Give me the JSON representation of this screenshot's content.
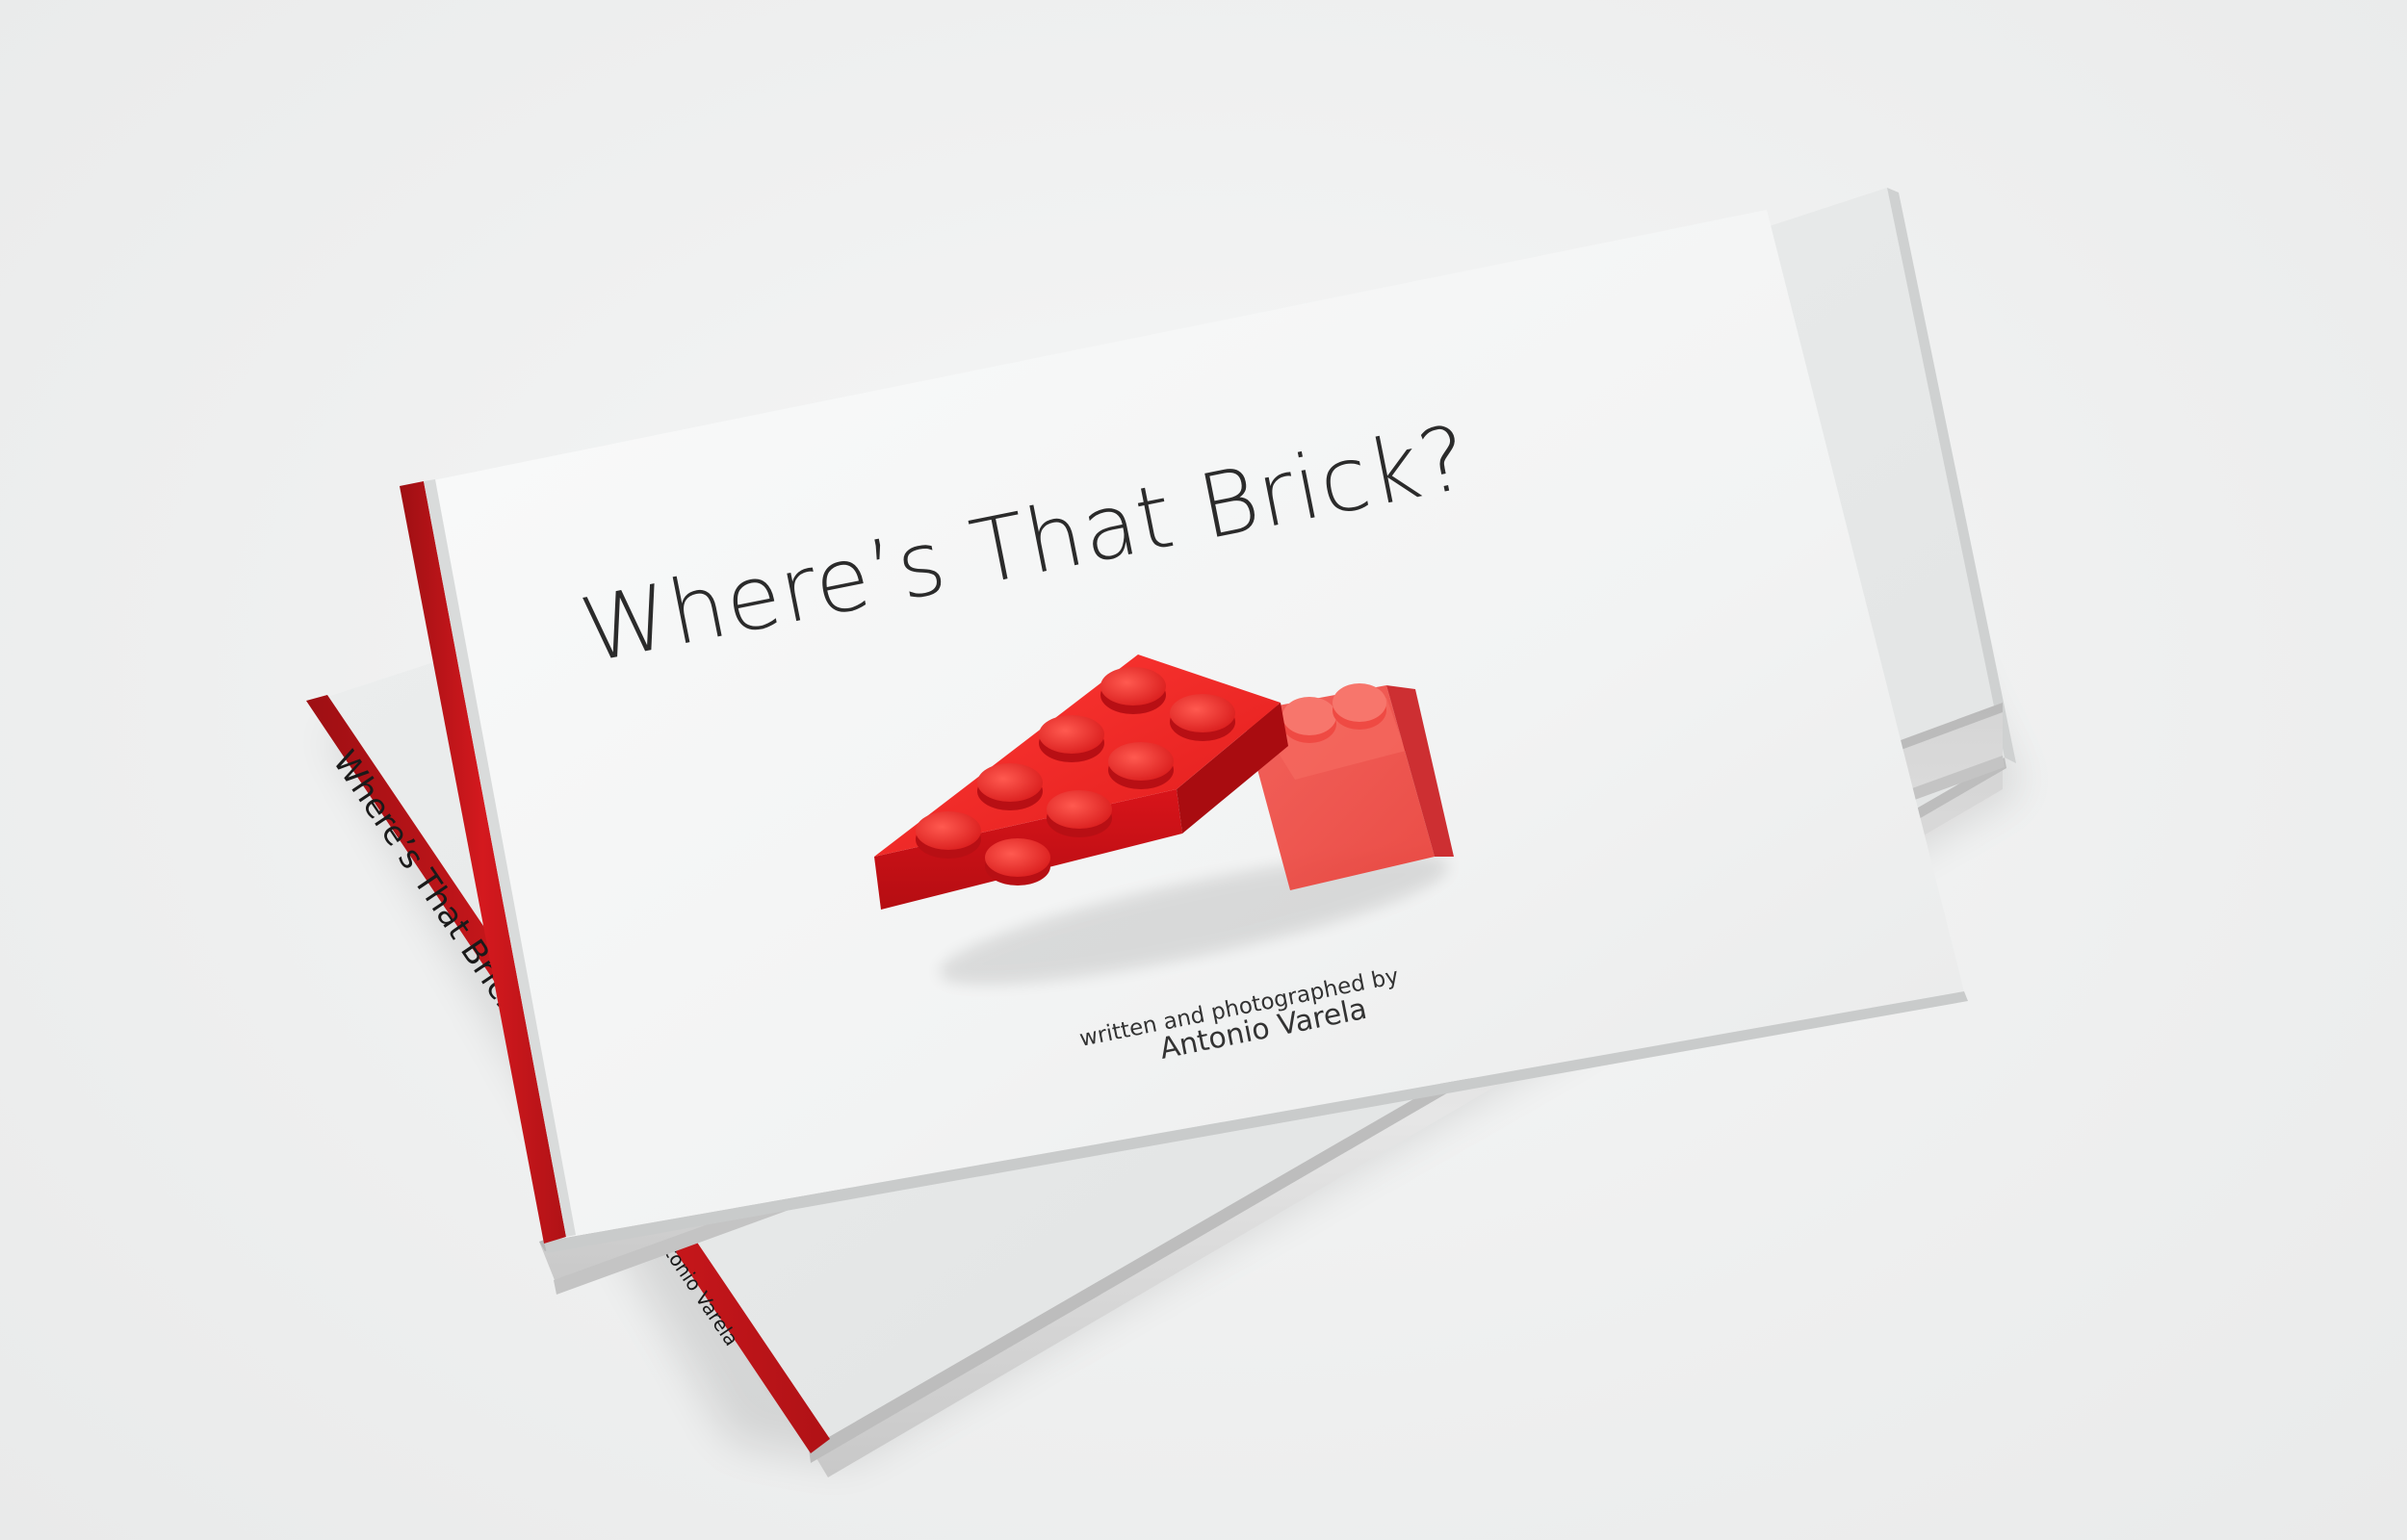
{
  "scene": {
    "description_colors": {
      "background": "#eeefef",
      "cover": "#f4f5f5",
      "pages": "#dcdcdc",
      "spine_red": "#c9161b",
      "brick_red": "#e8211f",
      "text": "#2b2b2b"
    }
  },
  "book_top": {
    "title": "Where’s That Brick?",
    "credit_line": "written and photographed by",
    "author": "Antonio Varela"
  },
  "book_bottom": {
    "spine_title": "Where’s That Brick?",
    "spine_author": "Antonio Varela"
  },
  "cover_image": {
    "icon": "red-lego-bricks-image"
  }
}
